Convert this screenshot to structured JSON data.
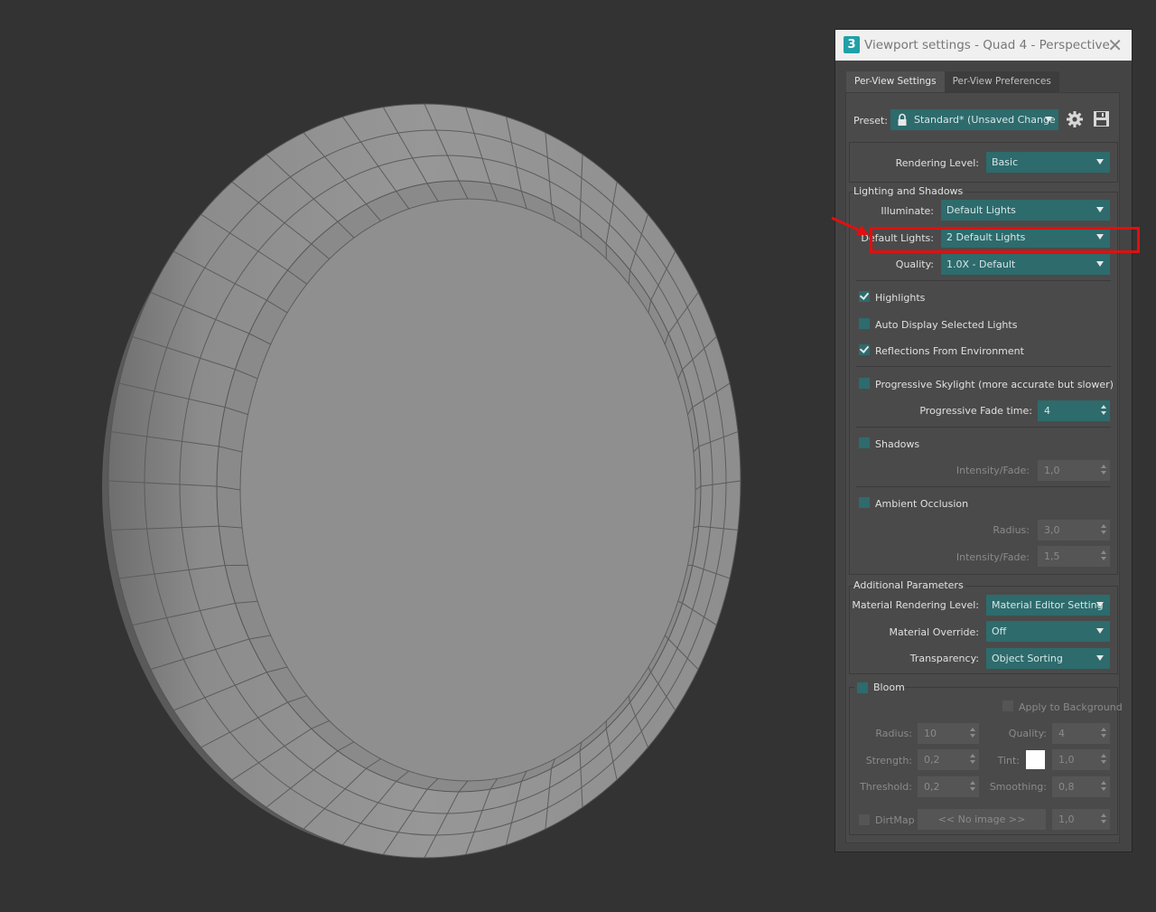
{
  "dialog": {
    "title": "Viewport settings - Quad 4 - Perspective",
    "app_icon": "3",
    "close_glyph": "✕"
  },
  "tabs": [
    {
      "label": "Per-View Settings",
      "active": true
    },
    {
      "label": "Per-View Preferences",
      "active": false
    }
  ],
  "preset": {
    "label": "Preset:",
    "value": "Standard* (Unsaved Change"
  },
  "rendering_level": {
    "label": "Rendering Level:",
    "value": "Basic"
  },
  "lighting": {
    "title": "Lighting and Shadows",
    "illuminate": {
      "label": "Illuminate:",
      "value": "Default Lights"
    },
    "default_lights": {
      "label": "Default Lights:",
      "value": "2 Default Lights"
    },
    "quality": {
      "label": "Quality:",
      "value": "1.0X - Default"
    },
    "highlights": {
      "label": "Highlights",
      "checked": true
    },
    "auto_display": {
      "label": "Auto Display Selected Lights",
      "checked": false
    },
    "reflections": {
      "label": "Reflections From Environment",
      "checked": true
    },
    "progressive_skylight": {
      "label": "Progressive Skylight (more accurate but slower)",
      "checked": false
    },
    "fade_time": {
      "label": "Progressive Fade time:",
      "value": "4"
    },
    "shadows": {
      "label": "Shadows",
      "checked": false
    },
    "shadow_intensity": {
      "label": "Intensity/Fade:",
      "value": "1,0"
    },
    "ambient_occlusion": {
      "label": "Ambient Occlusion",
      "checked": false
    },
    "ao_radius": {
      "label": "Radius:",
      "value": "3,0"
    },
    "ao_intensity": {
      "label": "Intensity/Fade:",
      "value": "1,5"
    }
  },
  "additional": {
    "title": "Additional Parameters",
    "material_rendering": {
      "label": "Material Rendering Level:",
      "value": "Material Editor Setting"
    },
    "material_override": {
      "label": "Material Override:",
      "value": "Off"
    },
    "transparency": {
      "label": "Transparency:",
      "value": "Object Sorting"
    }
  },
  "bloom": {
    "label": "Bloom",
    "apply_bg": "Apply to Background",
    "radius": {
      "label": "Radius:",
      "value": "10"
    },
    "quality": {
      "label": "Quality:",
      "value": "4"
    },
    "strength": {
      "label": "Strength:",
      "value": "0,2"
    },
    "tint": {
      "label": "Tint:",
      "value": "1,0"
    },
    "threshold": {
      "label": "Threshold:",
      "value": "0,2"
    },
    "smoothing": {
      "label": "Smoothing:",
      "value": "0,8"
    },
    "dirtmap": {
      "label": "DirtMap",
      "button": "<< No image >>",
      "value": "1,0"
    }
  },
  "colors": {
    "control_teal": "#2d6b6d",
    "annotation_red": "#e01010",
    "viewport_bg": "#333333"
  }
}
